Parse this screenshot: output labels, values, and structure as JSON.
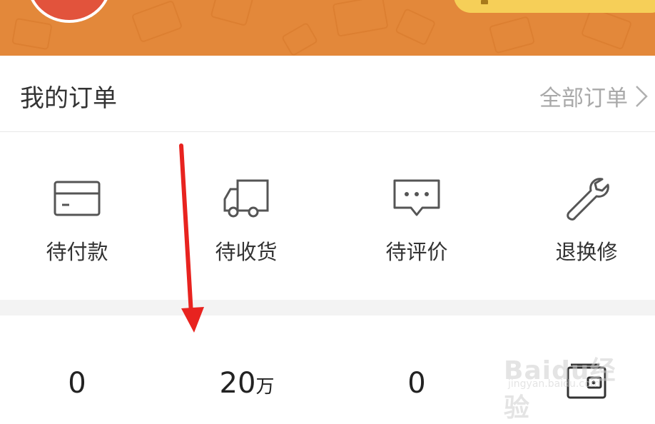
{
  "header": {
    "background_color": "#e3883a",
    "pill_color": "#f6cf58"
  },
  "orders": {
    "title": "我的订单",
    "all_orders_link": "全部订单"
  },
  "status_items": [
    {
      "label": "待付款",
      "icon": "card-icon"
    },
    {
      "label": "待收货",
      "icon": "truck-icon"
    },
    {
      "label": "待评价",
      "icon": "chat-bubble-icon"
    },
    {
      "label": "退换修",
      "icon": "wrench-icon"
    }
  ],
  "stats": [
    {
      "value": "0",
      "unit": ""
    },
    {
      "value": "20",
      "unit": "万"
    },
    {
      "value": "0",
      "unit": ""
    }
  ],
  "annotation": {
    "arrow_color": "#e8231f"
  },
  "watermark": {
    "main": "Baidu经验",
    "sub": "jingyan.baidu.com"
  }
}
